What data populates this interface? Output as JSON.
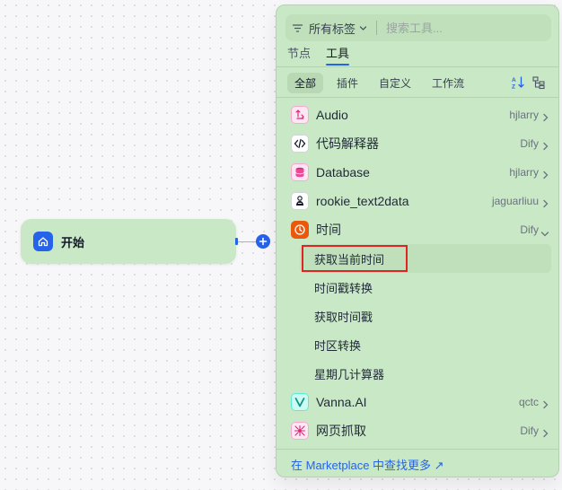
{
  "start_node": {
    "label": "开始"
  },
  "panel": {
    "filter_label": "所有标签",
    "search_placeholder": "搜索工具...",
    "tabs": [
      {
        "label": "节点",
        "active": false
      },
      {
        "label": "工具",
        "active": true
      }
    ],
    "subtabs": [
      {
        "label": "全部",
        "active": true
      },
      {
        "label": "插件",
        "active": false
      },
      {
        "label": "自定义",
        "active": false
      },
      {
        "label": "工作流",
        "active": false
      }
    ],
    "providers": [
      {
        "name": "Audio",
        "author": "hjlarry",
        "icon": "audio-icon"
      },
      {
        "name": "代码解释器",
        "author": "Dify",
        "icon": "code-icon"
      },
      {
        "name": "Database",
        "author": "hjlarry",
        "icon": "database-icon"
      },
      {
        "name": "rookie_text2data",
        "author": "jaguarliuu",
        "icon": "text2data-icon"
      },
      {
        "name": "时间",
        "author": "Dify",
        "icon": "clock-icon",
        "expanded": true
      }
    ],
    "time_tools": [
      "获取当前时间",
      "时间戳转换",
      "获取时间戳",
      "时区转换",
      "星期几计算器"
    ],
    "providers_after": [
      {
        "name": "Vanna.AI",
        "author": "qctc",
        "icon": "vanna-icon"
      },
      {
        "name": "网页抓取",
        "author": "Dify",
        "icon": "webscraper-icon"
      }
    ],
    "footer_link": "在 Marketplace 中查找更多 ↗"
  },
  "colors": {
    "accent": "#2563eb",
    "panel_bg": "#c9e8c6",
    "highlight_border": "#e02424"
  }
}
